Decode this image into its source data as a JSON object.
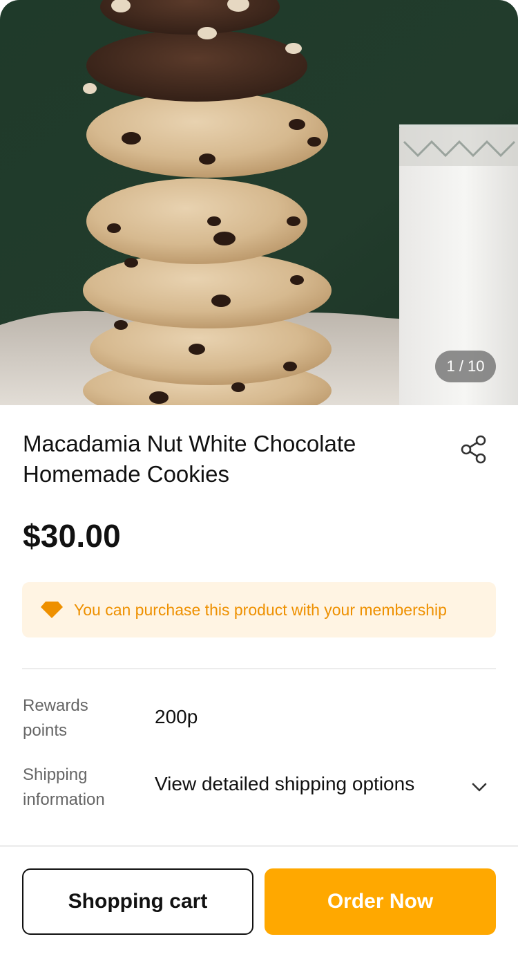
{
  "colors": {
    "accent": "#ffa800",
    "membership_bg": "#fff4e3",
    "membership_text": "#ee9000",
    "counter_bg": "#6e6e6e"
  },
  "gallery": {
    "counter": "1 / 10"
  },
  "product": {
    "title_line1": "Macadamia Nut White Chocolate",
    "title_line2": "Homemade Cookies",
    "price": "$30.00",
    "share_icon": "share-icon"
  },
  "membership": {
    "icon": "diamond-icon",
    "text": "You can purchase this product with your membership"
  },
  "details": {
    "rewards_label_line1": "Rewards",
    "rewards_label_line2": "points",
    "rewards_value": "200p",
    "shipping_label_line1": "Shipping",
    "shipping_label_line2": "information",
    "shipping_value": "View detailed shipping options",
    "shipping_icon": "chevron-down-icon"
  },
  "actions": {
    "cart_label": "Shopping cart",
    "order_label": "Order Now"
  }
}
